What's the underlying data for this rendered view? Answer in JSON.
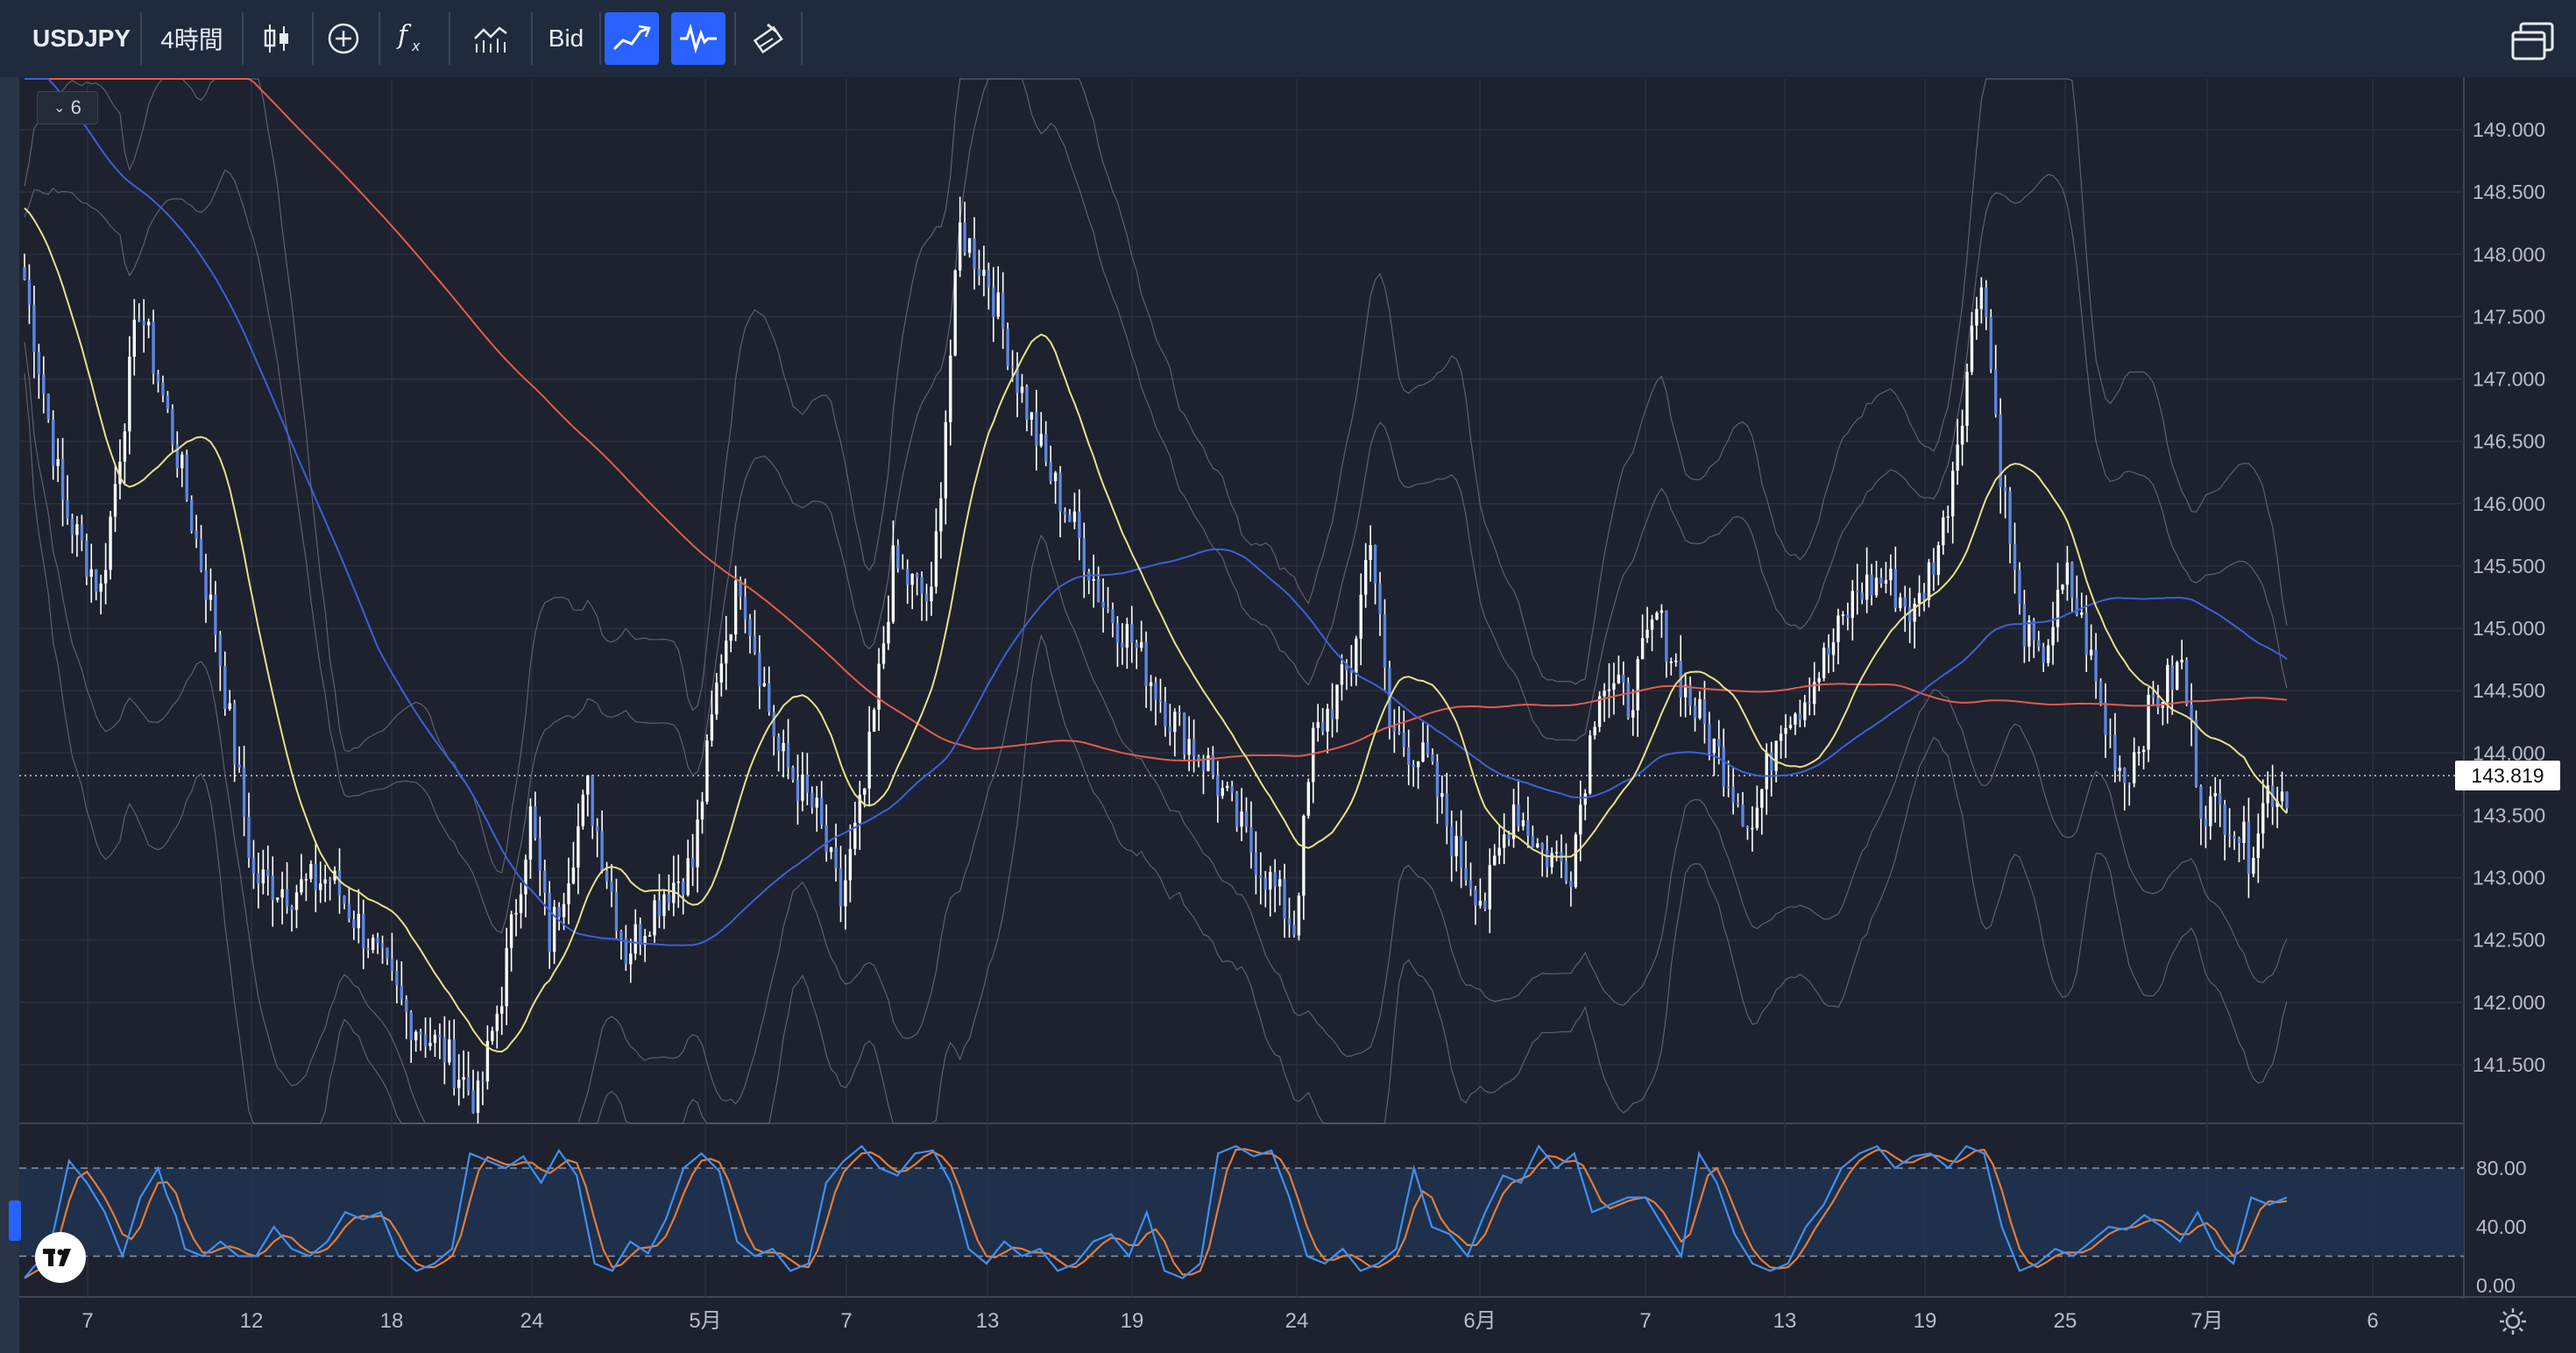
{
  "toolbar": {
    "symbol": "USDJPY",
    "interval": "4時間",
    "price_type": "Bid",
    "icons": [
      "candlestick-chart-icon",
      "add-indicator-icon",
      "fx-function-icon",
      "compare-chart-icon",
      "trend-line-icon",
      "oscillator-icon",
      "paint-brush-icon",
      "layout-windows-icon"
    ]
  },
  "legend": {
    "collapsed_count": "6"
  },
  "colors": {
    "background": "#1d222e",
    "candle_body": "#5e86e0",
    "candle_wick": "#ffffff",
    "ma_short": "#e8e08a",
    "ma_mid": "#3f5fd6",
    "ma_long": "#e45b4b",
    "bands": "#5a6070",
    "stoch_k": "#3f8ff2",
    "stoch_d": "#e37b3a"
  },
  "price_axis": {
    "labels": [
      "149.000",
      "148.500",
      "148.000",
      "147.500",
      "147.000",
      "146.500",
      "146.000",
      "145.500",
      "145.000",
      "144.500",
      "144.000",
      "143.500",
      "143.000",
      "142.500",
      "142.000",
      "141.500"
    ],
    "last_price": "143.819"
  },
  "oscillator_axis": {
    "labels": [
      "80.00",
      "40.00",
      "0.00"
    ]
  },
  "date_axis": {
    "labels": [
      "7",
      "12",
      "18",
      "24",
      "5月",
      "7",
      "13",
      "19",
      "24",
      "6月",
      "7",
      "13",
      "19",
      "25",
      "7月",
      "6"
    ]
  },
  "chart_data": {
    "type": "candlestick",
    "instrument": "USDJPY",
    "interval": "4時間",
    "ylim": [
      141.1,
      149.45
    ],
    "last_price": 143.819,
    "close_path": [
      [
        0,
        147.8
      ],
      [
        8,
        146.0
      ],
      [
        16,
        145.3
      ],
      [
        24,
        147.6
      ],
      [
        32,
        146.4
      ],
      [
        40,
        145.0
      ],
      [
        48,
        143.0
      ],
      [
        56,
        142.9
      ],
      [
        64,
        143.0
      ],
      [
        72,
        142.5
      ],
      [
        80,
        141.9
      ],
      [
        88,
        141.6
      ],
      [
        95,
        141.2
      ],
      [
        100,
        142.1
      ],
      [
        106,
        143.5
      ],
      [
        110,
        142.5
      ],
      [
        118,
        143.7
      ],
      [
        126,
        142.4
      ],
      [
        134,
        142.9
      ],
      [
        140,
        143.1
      ],
      [
        146,
        144.8
      ],
      [
        150,
        145.4
      ],
      [
        158,
        144.0
      ],
      [
        166,
        143.5
      ],
      [
        171,
        142.8
      ],
      [
        176,
        143.7
      ],
      [
        182,
        145.5
      ],
      [
        190,
        145.2
      ],
      [
        196,
        148.2
      ],
      [
        202,
        147.8
      ],
      [
        208,
        147.0
      ],
      [
        214,
        146.3
      ],
      [
        220,
        145.8
      ],
      [
        226,
        145.2
      ],
      [
        232,
        144.9
      ],
      [
        240,
        144.3
      ],
      [
        248,
        143.9
      ],
      [
        256,
        143.3
      ],
      [
        262,
        142.9
      ],
      [
        266,
        142.6
      ],
      [
        270,
        144.1
      ],
      [
        278,
        144.7
      ],
      [
        282,
        145.8
      ],
      [
        286,
        144.2
      ],
      [
        294,
        143.9
      ],
      [
        300,
        143.2
      ],
      [
        306,
        142.8
      ],
      [
        312,
        143.6
      ],
      [
        318,
        143.2
      ],
      [
        324,
        143.1
      ],
      [
        330,
        144.6
      ],
      [
        336,
        144.4
      ],
      [
        342,
        145.1
      ],
      [
        348,
        144.5
      ],
      [
        356,
        143.9
      ],
      [
        362,
        143.4
      ],
      [
        368,
        144.3
      ],
      [
        372,
        144.4
      ],
      [
        378,
        144.8
      ],
      [
        384,
        145.3
      ],
      [
        390,
        145.4
      ],
      [
        396,
        145.1
      ],
      [
        402,
        145.8
      ],
      [
        406,
        146.8
      ],
      [
        410,
        147.9
      ],
      [
        414,
        146.3
      ],
      [
        418,
        145.1
      ],
      [
        422,
        144.7
      ],
      [
        428,
        145.4
      ],
      [
        432,
        144.9
      ],
      [
        436,
        144.2
      ],
      [
        440,
        143.8
      ],
      [
        446,
        144.4
      ],
      [
        452,
        144.7
      ],
      [
        456,
        143.6
      ],
      [
        462,
        143.5
      ],
      [
        466,
        143.2
      ],
      [
        470,
        143.7
      ]
    ],
    "moving_averages": [
      "short",
      "medium",
      "long"
    ],
    "bollinger_bands": true,
    "oscillator": {
      "type": "stochastic",
      "ylim": [
        0,
        100
      ],
      "levels": [
        20,
        80
      ],
      "k_points": [
        [
          0,
          5
        ],
        [
          3,
          15
        ],
        [
          6,
          30
        ],
        [
          10,
          85
        ],
        [
          14,
          70
        ],
        [
          18,
          50
        ],
        [
          22,
          20
        ],
        [
          26,
          60
        ],
        [
          30,
          80
        ],
        [
          33,
          55
        ],
        [
          36,
          25
        ],
        [
          40,
          20
        ],
        [
          44,
          30
        ],
        [
          48,
          20
        ],
        [
          52,
          20
        ],
        [
          56,
          40
        ],
        [
          60,
          25
        ],
        [
          64,
          20
        ],
        [
          68,
          30
        ],
        [
          72,
          50
        ],
        [
          76,
          45
        ],
        [
          80,
          50
        ],
        [
          84,
          20
        ],
        [
          88,
          10
        ],
        [
          92,
          15
        ],
        [
          96,
          25
        ],
        [
          100,
          90
        ],
        [
          104,
          85
        ],
        [
          108,
          80
        ],
        [
          112,
          88
        ],
        [
          116,
          70
        ],
        [
          120,
          92
        ],
        [
          124,
          75
        ],
        [
          128,
          15
        ],
        [
          132,
          10
        ],
        [
          136,
          30
        ],
        [
          140,
          22
        ],
        [
          144,
          45
        ],
        [
          148,
          80
        ],
        [
          152,
          90
        ],
        [
          156,
          78
        ],
        [
          160,
          30
        ],
        [
          164,
          20
        ],
        [
          168,
          25
        ],
        [
          172,
          10
        ],
        [
          176,
          15
        ],
        [
          180,
          70
        ],
        [
          184,
          85
        ],
        [
          188,
          95
        ],
        [
          192,
          80
        ],
        [
          196,
          75
        ],
        [
          200,
          90
        ],
        [
          204,
          92
        ],
        [
          208,
          70
        ],
        [
          212,
          25
        ],
        [
          216,
          15
        ],
        [
          220,
          30
        ],
        [
          224,
          20
        ],
        [
          228,
          25
        ],
        [
          232,
          10
        ],
        [
          236,
          15
        ],
        [
          240,
          30
        ],
        [
          244,
          35
        ],
        [
          248,
          20
        ],
        [
          252,
          50
        ],
        [
          256,
          10
        ],
        [
          260,
          5
        ],
        [
          264,
          15
        ],
        [
          268,
          90
        ],
        [
          272,
          95
        ],
        [
          276,
          88
        ],
        [
          280,
          92
        ],
        [
          284,
          60
        ],
        [
          288,
          20
        ],
        [
          292,
          15
        ],
        [
          296,
          25
        ],
        [
          300,
          10
        ],
        [
          304,
          15
        ],
        [
          308,
          25
        ],
        [
          312,
          80
        ],
        [
          316,
          40
        ],
        [
          320,
          35
        ],
        [
          324,
          20
        ],
        [
          328,
          50
        ],
        [
          332,
          75
        ],
        [
          336,
          70
        ],
        [
          340,
          95
        ],
        [
          344,
          80
        ],
        [
          348,
          90
        ],
        [
          352,
          50
        ],
        [
          356,
          55
        ],
        [
          360,
          60
        ],
        [
          364,
          60
        ],
        [
          368,
          40
        ],
        [
          372,
          20
        ],
        [
          376,
          90
        ],
        [
          380,
          70
        ],
        [
          384,
          35
        ],
        [
          388,
          15
        ],
        [
          392,
          10
        ],
        [
          396,
          15
        ],
        [
          400,
          40
        ],
        [
          404,
          55
        ],
        [
          408,
          80
        ],
        [
          412,
          90
        ],
        [
          416,
          95
        ],
        [
          420,
          80
        ],
        [
          424,
          88
        ],
        [
          428,
          90
        ],
        [
          432,
          80
        ],
        [
          436,
          95
        ],
        [
          440,
          90
        ],
        [
          444,
          40
        ],
        [
          448,
          10
        ],
        [
          452,
          15
        ],
        [
          456,
          25
        ],
        [
          460,
          20
        ],
        [
          464,
          30
        ],
        [
          468,
          40
        ],
        [
          472,
          38
        ],
        [
          476,
          48
        ],
        [
          480,
          40
        ],
        [
          484,
          30
        ],
        [
          488,
          50
        ],
        [
          492,
          25
        ],
        [
          496,
          15
        ],
        [
          500,
          60
        ],
        [
          504,
          55
        ],
        [
          508,
          60
        ]
      ]
    }
  }
}
